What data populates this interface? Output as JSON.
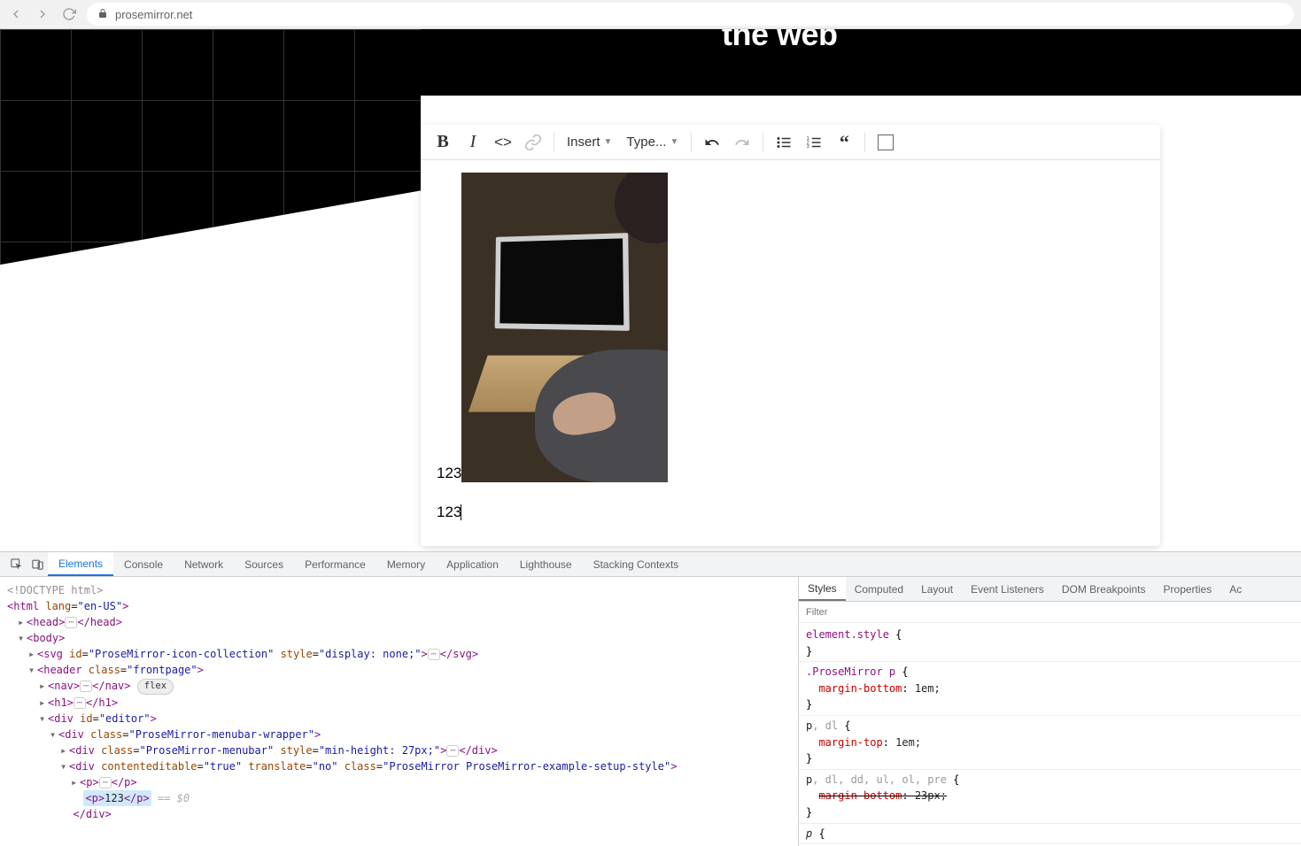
{
  "browser": {
    "url": "prosemirror.net"
  },
  "headline": "the web",
  "menubar": {
    "insert_label": "Insert",
    "type_label": "Type..."
  },
  "editor": {
    "line1_text": "123",
    "line2_text": "123"
  },
  "devtools": {
    "tabs": [
      "Elements",
      "Console",
      "Network",
      "Sources",
      "Performance",
      "Memory",
      "Application",
      "Lighthouse",
      "Stacking Contexts"
    ],
    "active_tab": "Elements",
    "side_tabs": [
      "Styles",
      "Computed",
      "Layout",
      "Event Listeners",
      "DOM Breakpoints",
      "Properties",
      "Ac"
    ],
    "active_side_tab": "Styles",
    "filter_placeholder": "Filter",
    "dom": {
      "doctype": "<!DOCTYPE html>",
      "html_open": "<html lang=\"en-US\">",
      "head": "<head>…</head>",
      "body_open": "<body>",
      "svg": "<svg id=\"ProseMirror-icon-collection\" style=\"display: none;\">…</svg>",
      "header_open": "<header class=\"frontpage\">",
      "nav": "<nav>…</nav>",
      "nav_pill": "flex",
      "h1": "<h1>…</h1>",
      "editor_open": "<div id=\"editor\">",
      "wrap_open": "<div class=\"ProseMirror-menubar-wrapper\">",
      "menubar_div": "<div class=\"ProseMirror-menubar\" style=\"min-height: 27px;\">…</div>",
      "pm_open": "<div contenteditable=\"true\" translate=\"no\" class=\"ProseMirror ProseMirror-example-setup-style\">",
      "p_ell": "<p>…</p>",
      "p_sel_open": "<p>",
      "p_sel_text": "123",
      "p_sel_close": "</p>",
      "eq_sel": " == $0",
      "div_close": "</div>"
    },
    "styles": {
      "r0": {
        "sel": "element.style",
        "open": " {",
        "close": "}"
      },
      "r1": {
        "sel": ".ProseMirror p",
        "open": " {",
        "p1": "margin-bottom",
        "v1": "1em;",
        "close": "}"
      },
      "r2": {
        "sel_pre": "p",
        "sel_post": ", dl",
        "open": " {",
        "p1": "margin-top",
        "v1": "1em;",
        "close": "}"
      },
      "r3": {
        "sel_pre": "p",
        "sel_post": ", dl, dd, ul, ol, pre",
        "open": " {",
        "p1": "margin-bottom",
        "v1": "23px;",
        "close": "}"
      },
      "r4": {
        "sel": "p",
        "open": " {"
      }
    }
  }
}
